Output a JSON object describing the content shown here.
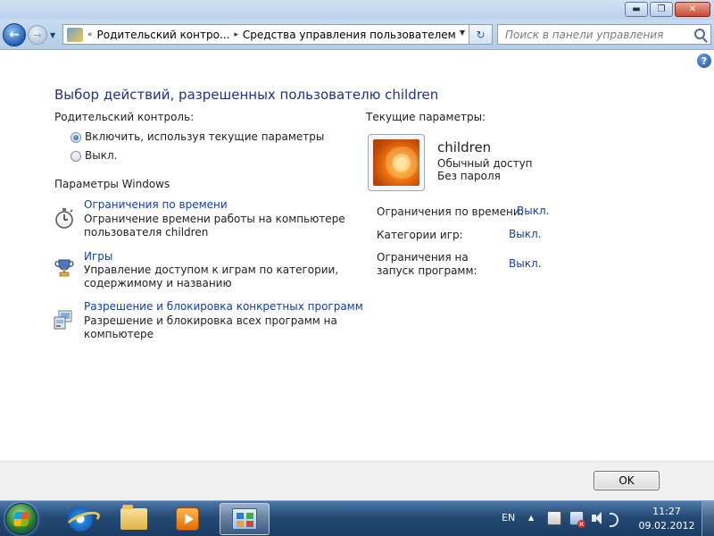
{
  "window": {
    "minimize_glyph": "▬",
    "maximize_glyph": "❐",
    "close_glyph": "✕"
  },
  "nav": {
    "back_glyph": "←",
    "forward_glyph": "→",
    "address": {
      "overflow_glyph": "«",
      "crumbs": [
        "Родительский контро...",
        "Средства управления пользователем"
      ],
      "separator": "▸"
    },
    "refresh_glyph": "↻",
    "search": {
      "placeholder": "Поиск в панели управления"
    }
  },
  "content": {
    "title": "Выбор действий, разрешенных пользователю children",
    "parental_control_label": "Родительский контроль:",
    "options": [
      {
        "label": "Включить, используя текущие параметры",
        "checked": true
      },
      {
        "label": "Выкл.",
        "checked": false
      }
    ],
    "windows_settings_label": "Параметры Windows",
    "tasks": [
      {
        "icon": "stopwatch-icon",
        "link": "Ограничения по времени",
        "desc_line1": "Ограничение времени работы на компьютере",
        "desc_line2": "пользователя children"
      },
      {
        "icon": "trophy-icon",
        "link": "Игры",
        "desc_line1": "Управление доступом к играм по категории,",
        "desc_line2": "содержимому и названию"
      },
      {
        "icon": "programs-icon",
        "link": "Разрешение и блокировка конкретных программ",
        "desc_line1": "Разрешение и блокировка всех программ на",
        "desc_line2": "компьютере"
      }
    ],
    "current_settings_label": "Текущие параметры:",
    "user": {
      "name": "children",
      "account_type": "Обычный доступ",
      "password": "Без пароля"
    },
    "settings": [
      {
        "label": "Ограничения по времени:",
        "value": "Выкл."
      },
      {
        "label": "Категории игр:",
        "value": "Выкл."
      },
      {
        "label_line1": "Ограничения на",
        "label_line2": "запуск программ:",
        "value": "Выкл."
      }
    ],
    "ok_label": "OK"
  },
  "taskbar": {
    "lang": "EN",
    "tray_arrow": "▲",
    "time": "11:27",
    "date": "09.02.2012"
  },
  "colors": {
    "title": "#1e3287",
    "link": "#0e3fa3"
  }
}
